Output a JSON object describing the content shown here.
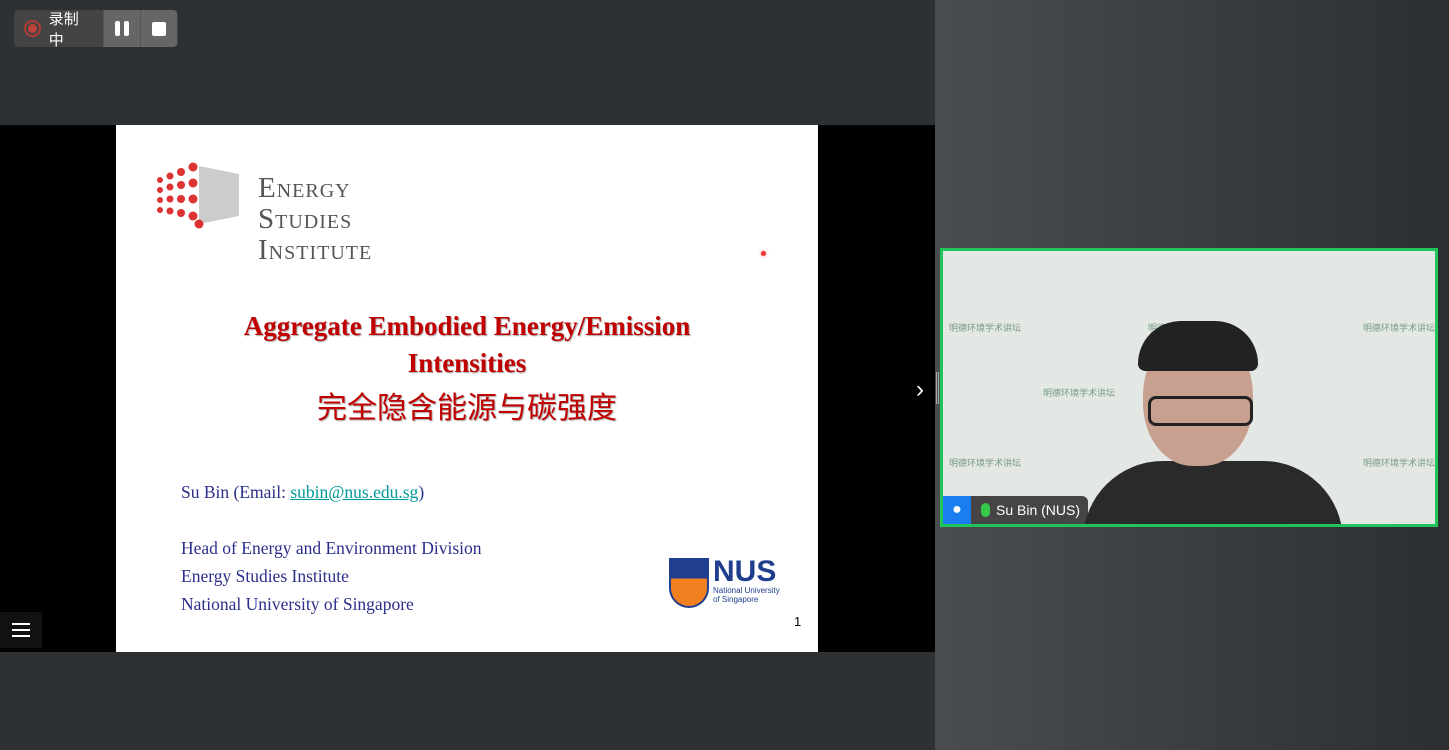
{
  "recording": {
    "label": "录制中",
    "pause": "pause-icon",
    "stop": "stop-icon",
    "accent": "#c0403a"
  },
  "slide": {
    "logo_lines": [
      "Energy",
      "Studies",
      "Institute"
    ],
    "title_en_1": "Aggregate Embodied Energy/Emission",
    "title_en_2": "Intensities",
    "title_zh": "完全隐含能源与碳强度",
    "author_prefix": "Su Bin (Email: ",
    "email": "subin@nus.edu.sg",
    "author_suffix": ")",
    "affil": [
      "Head of Energy and Environment Division",
      "Energy Studies Institute",
      "National University of Singapore"
    ],
    "nus_logo": "NUS",
    "nus_sub1": "National University",
    "nus_sub2": "of Singapore",
    "page": "1",
    "title_color": "#c00000"
  },
  "video": {
    "name": "Su Bin (NUS)",
    "border_color": "#1fc45b",
    "watermark": "明德环境学术讲坛"
  }
}
